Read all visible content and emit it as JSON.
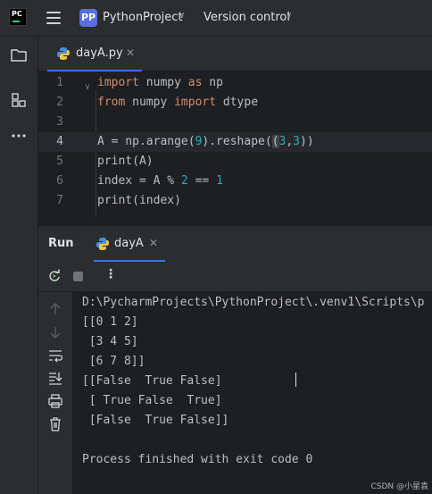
{
  "title_bar": {
    "logo_text": "PC",
    "project_badge": "PP",
    "project_name": "PythonProject",
    "vcs_label": "Version control"
  },
  "editor": {
    "tab_label": "dayA.py",
    "lines": [
      {
        "num": "1"
      },
      {
        "num": "2"
      },
      {
        "num": "3"
      },
      {
        "num": "4"
      },
      {
        "num": "5"
      },
      {
        "num": "6"
      },
      {
        "num": "7"
      }
    ],
    "code": {
      "l1_kw1": "import",
      "l1_mid": " numpy ",
      "l1_kw2": "as",
      "l1_end": " np",
      "l2_kw1": "from",
      "l2_mid": " numpy ",
      "l2_kw2": "import",
      "l2_end": " dtype",
      "l4_a": "A = np.arange(",
      "l4_n1": "9",
      "l4_b": ").reshape(",
      "l4_paren": "(",
      "l4_n2": "3",
      "l4_comma": ",",
      "l4_n3": "3",
      "l4_end": "))",
      "l5": "print(A)",
      "l6_a": "index = A % ",
      "l6_n1": "2",
      "l6_b": " == ",
      "l6_n2": "1",
      "l7": "print(index)"
    }
  },
  "run_panel": {
    "title": "Run",
    "tab_label": "dayA",
    "output": [
      "D:\\PycharmProjects\\PythonProject\\.venv1\\Scripts\\p",
      "[[0 1 2]",
      " [3 4 5]",
      " [6 7 8]]",
      "[[False  True False]",
      " [ True False  True]",
      " [False  True False]]",
      "",
      "Process finished with exit code 0"
    ]
  },
  "watermark": "CSDN @小星袁",
  "colors": {
    "accent": "#3574f0",
    "keyword": "#cf8e6d",
    "number": "#2aacb8",
    "text": "#bcbec4",
    "background": "#1e1f22",
    "panel": "#2b2d30"
  },
  "icons": {
    "tool_strip": [
      "folder-icon",
      "structure-icon",
      "more-icon"
    ],
    "console_side": [
      "arrow-up-icon",
      "arrow-down-icon",
      "soft-wrap-icon",
      "scroll-to-end-icon",
      "print-icon",
      "trash-icon"
    ]
  }
}
